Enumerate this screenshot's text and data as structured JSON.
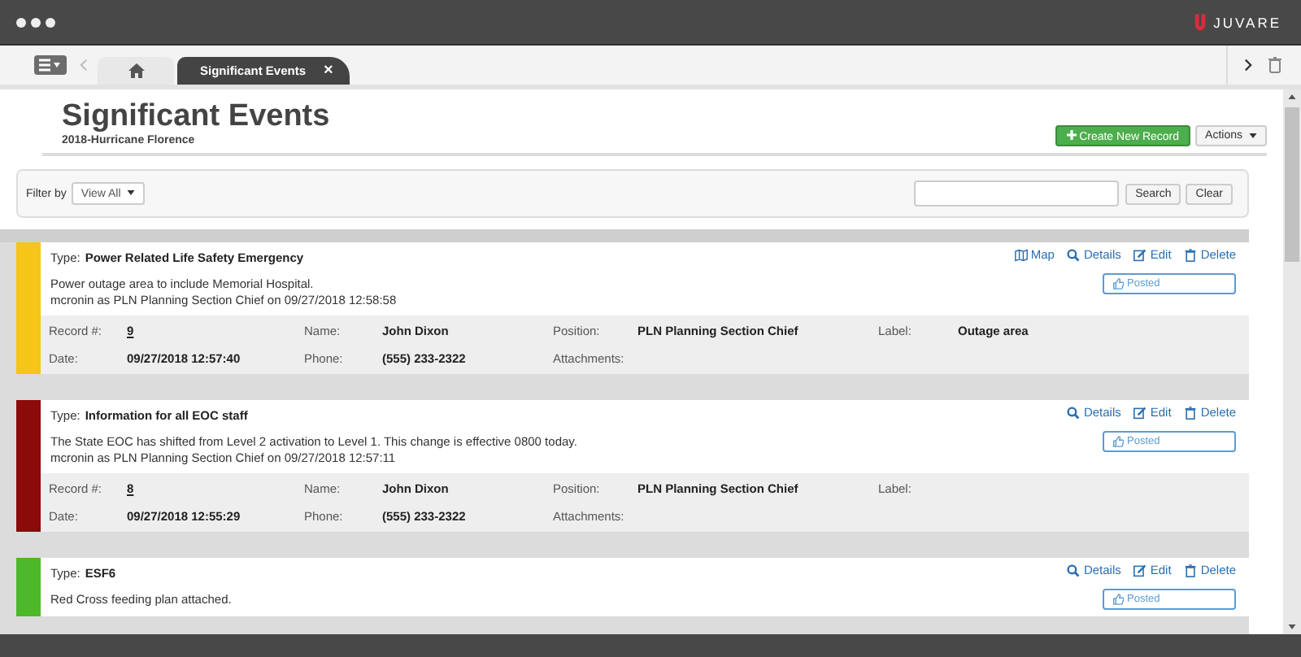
{
  "brand": "JUVARE",
  "tabs": [
    {
      "kind": "home",
      "selected": false
    },
    {
      "kind": "page",
      "label": "Significant Events",
      "close": "×",
      "selected": true
    }
  ],
  "header": {
    "title": "Significant Events",
    "subtitle": "2018-Hurricane Florence",
    "create_button": "Create New Record",
    "actions_button": "Actions"
  },
  "filter": {
    "label": "Filter by",
    "value": "View All",
    "search_button": "Search",
    "clear_button": "Clear"
  },
  "events": [
    {
      "color": "#f5c518",
      "type_label": "Type:",
      "type": "Power Related Life Safety Emergency",
      "actions": [
        {
          "kind": "map",
          "label": "Map"
        },
        {
          "kind": "details",
          "label": "Details"
        },
        {
          "kind": "edit",
          "label": "Edit"
        },
        {
          "kind": "delete",
          "label": "Delete"
        }
      ],
      "lines": [
        "Power outage area to include Memorial Hospital.",
        "mcronin as PLN Planning Section Chief on 09/27/2018 12:58:58"
      ],
      "posted": "Posted",
      "details": [
        {
          "label": "Record #:",
          "value": "9",
          "kind": "link"
        },
        {
          "label": "Name:",
          "value": "John Dixon"
        },
        {
          "label": "Position:",
          "value": "PLN Planning Section Chief"
        },
        {
          "label": "Label:",
          "value": "Outage area"
        },
        {
          "label": "Date:",
          "value": "09/27/2018 12:57:40"
        },
        {
          "label": "Phone:",
          "value": "(555) 233-2322"
        },
        {
          "label": "Attachments:"
        }
      ]
    },
    {
      "color": "#8b0a0a",
      "type_label": "Type:",
      "type": "Information for all EOC staff",
      "actions": [
        {
          "kind": "details",
          "label": "Details"
        },
        {
          "kind": "edit",
          "label": "Edit"
        },
        {
          "kind": "delete",
          "label": "Delete"
        }
      ],
      "lines": [
        "The State EOC has shifted from Level 2 activation to Level 1. This change is effective 0800 today.",
        "mcronin as PLN Planning Section Chief on 09/27/2018 12:57:11"
      ],
      "posted": "Posted",
      "details": [
        {
          "label": "Record #:",
          "value": "8",
          "kind": "link"
        },
        {
          "label": "Name:",
          "value": "John Dixon"
        },
        {
          "label": "Position:",
          "value": "PLN Planning Section Chief"
        },
        {
          "label": "Label:"
        },
        {
          "label": "Date:",
          "value": "09/27/2018 12:55:29"
        },
        {
          "label": "Phone:",
          "value": "(555) 233-2322"
        },
        {
          "label": "Attachments:"
        }
      ]
    },
    {
      "color": "#4cb82a",
      "type_label": "Type:",
      "type": "ESF6",
      "actions": [
        {
          "kind": "details",
          "label": "Details"
        },
        {
          "kind": "edit",
          "label": "Edit"
        },
        {
          "kind": "delete",
          "label": "Delete"
        }
      ],
      "lines": [
        "Red Cross feeding plan attached."
      ],
      "posted": "Posted"
    }
  ]
}
